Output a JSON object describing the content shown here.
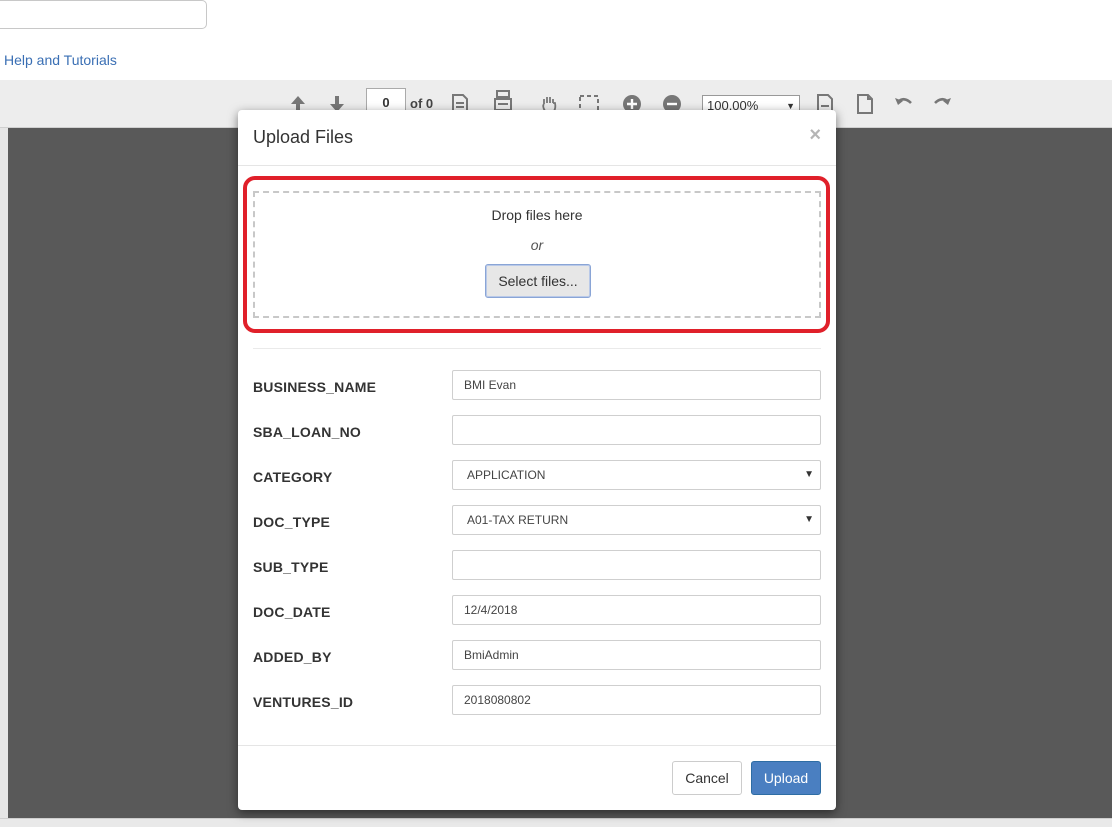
{
  "page": {
    "help_link": "Help and Tutorials"
  },
  "viewer_toolbar": {
    "page_number": "0",
    "of_label": "of 0",
    "zoom": "100.00%",
    "icons": [
      "arrow-up-icon",
      "arrow-down-icon",
      "page-icon",
      "page-print-icon",
      "hand-icon",
      "select-area-icon",
      "zoom-in-icon",
      "zoom-out-icon",
      "document-icon",
      "document-alt-icon",
      "undo-icon",
      "redo-icon"
    ]
  },
  "modal": {
    "title": "Upload Files",
    "close_glyph": "×",
    "dropzone": {
      "drop_text": "Drop files here",
      "or_text": "or",
      "select_label": "Select files..."
    },
    "fields": [
      {
        "label": "BUSINESS_NAME",
        "value": "BMI Evan",
        "type": "text"
      },
      {
        "label": "SBA_LOAN_NO",
        "value": "",
        "type": "text"
      },
      {
        "label": "CATEGORY",
        "value": "APPLICATION",
        "type": "select"
      },
      {
        "label": "DOC_TYPE",
        "value": "A01-TAX RETURN",
        "type": "select"
      },
      {
        "label": "SUB_TYPE",
        "value": "",
        "type": "text"
      },
      {
        "label": "DOC_DATE",
        "value": "12/4/2018",
        "type": "text"
      },
      {
        "label": "ADDED_BY",
        "value": "BmiAdmin",
        "type": "text"
      },
      {
        "label": "VENTURES_ID",
        "value": "2018080802",
        "type": "text"
      }
    ],
    "cancel_label": "Cancel",
    "upload_label": "Upload"
  },
  "colors": {
    "highlight": "#e0202a",
    "primary": "#4a7fc1",
    "link": "#3a6fb4",
    "viewer_bg": "#595959"
  }
}
